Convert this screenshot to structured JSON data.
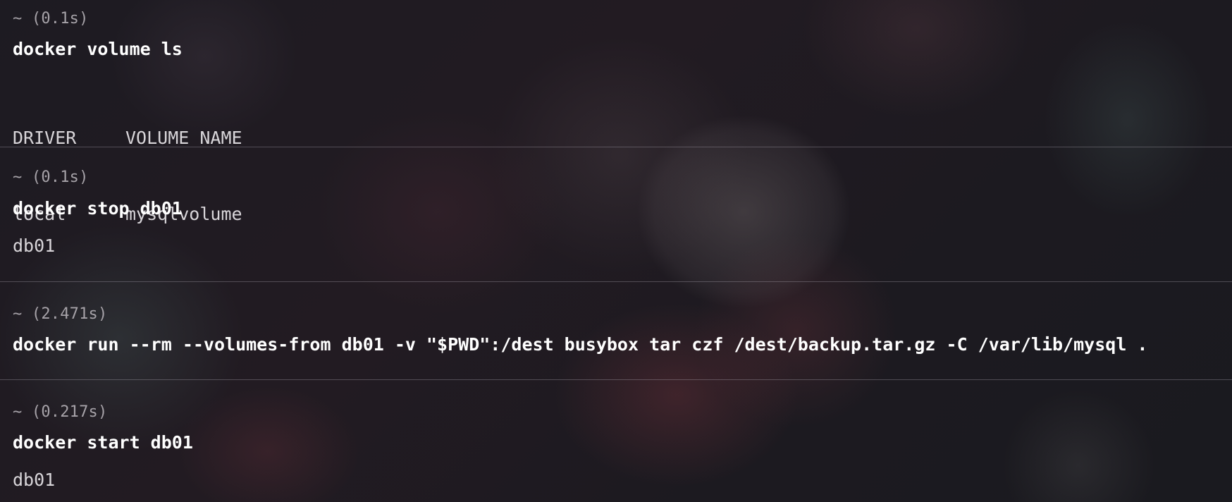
{
  "blocks": [
    {
      "prompt": "~ (0.1s)",
      "command": "docker volume ls",
      "table": {
        "headers": [
          "DRIVER",
          "VOLUME NAME"
        ],
        "rows": [
          [
            "local",
            "mysqlvolume"
          ]
        ]
      }
    },
    {
      "prompt": "~ (0.1s)",
      "command": "docker stop db01",
      "output": "db01"
    },
    {
      "prompt": "~ (2.471s)",
      "command": "docker run --rm --volumes-from db01 -v \"$PWD\":/dest busybox tar czf /dest/backup.tar.gz -C /var/lib/mysql ."
    },
    {
      "prompt": "~ (0.217s)",
      "command": "docker start db01",
      "output": "db01"
    }
  ],
  "colors": {
    "prompt": "#a6a2a8",
    "command": "#ffffff",
    "output": "#d8d5d9",
    "divider": "rgba(190,185,195,0.32)"
  }
}
